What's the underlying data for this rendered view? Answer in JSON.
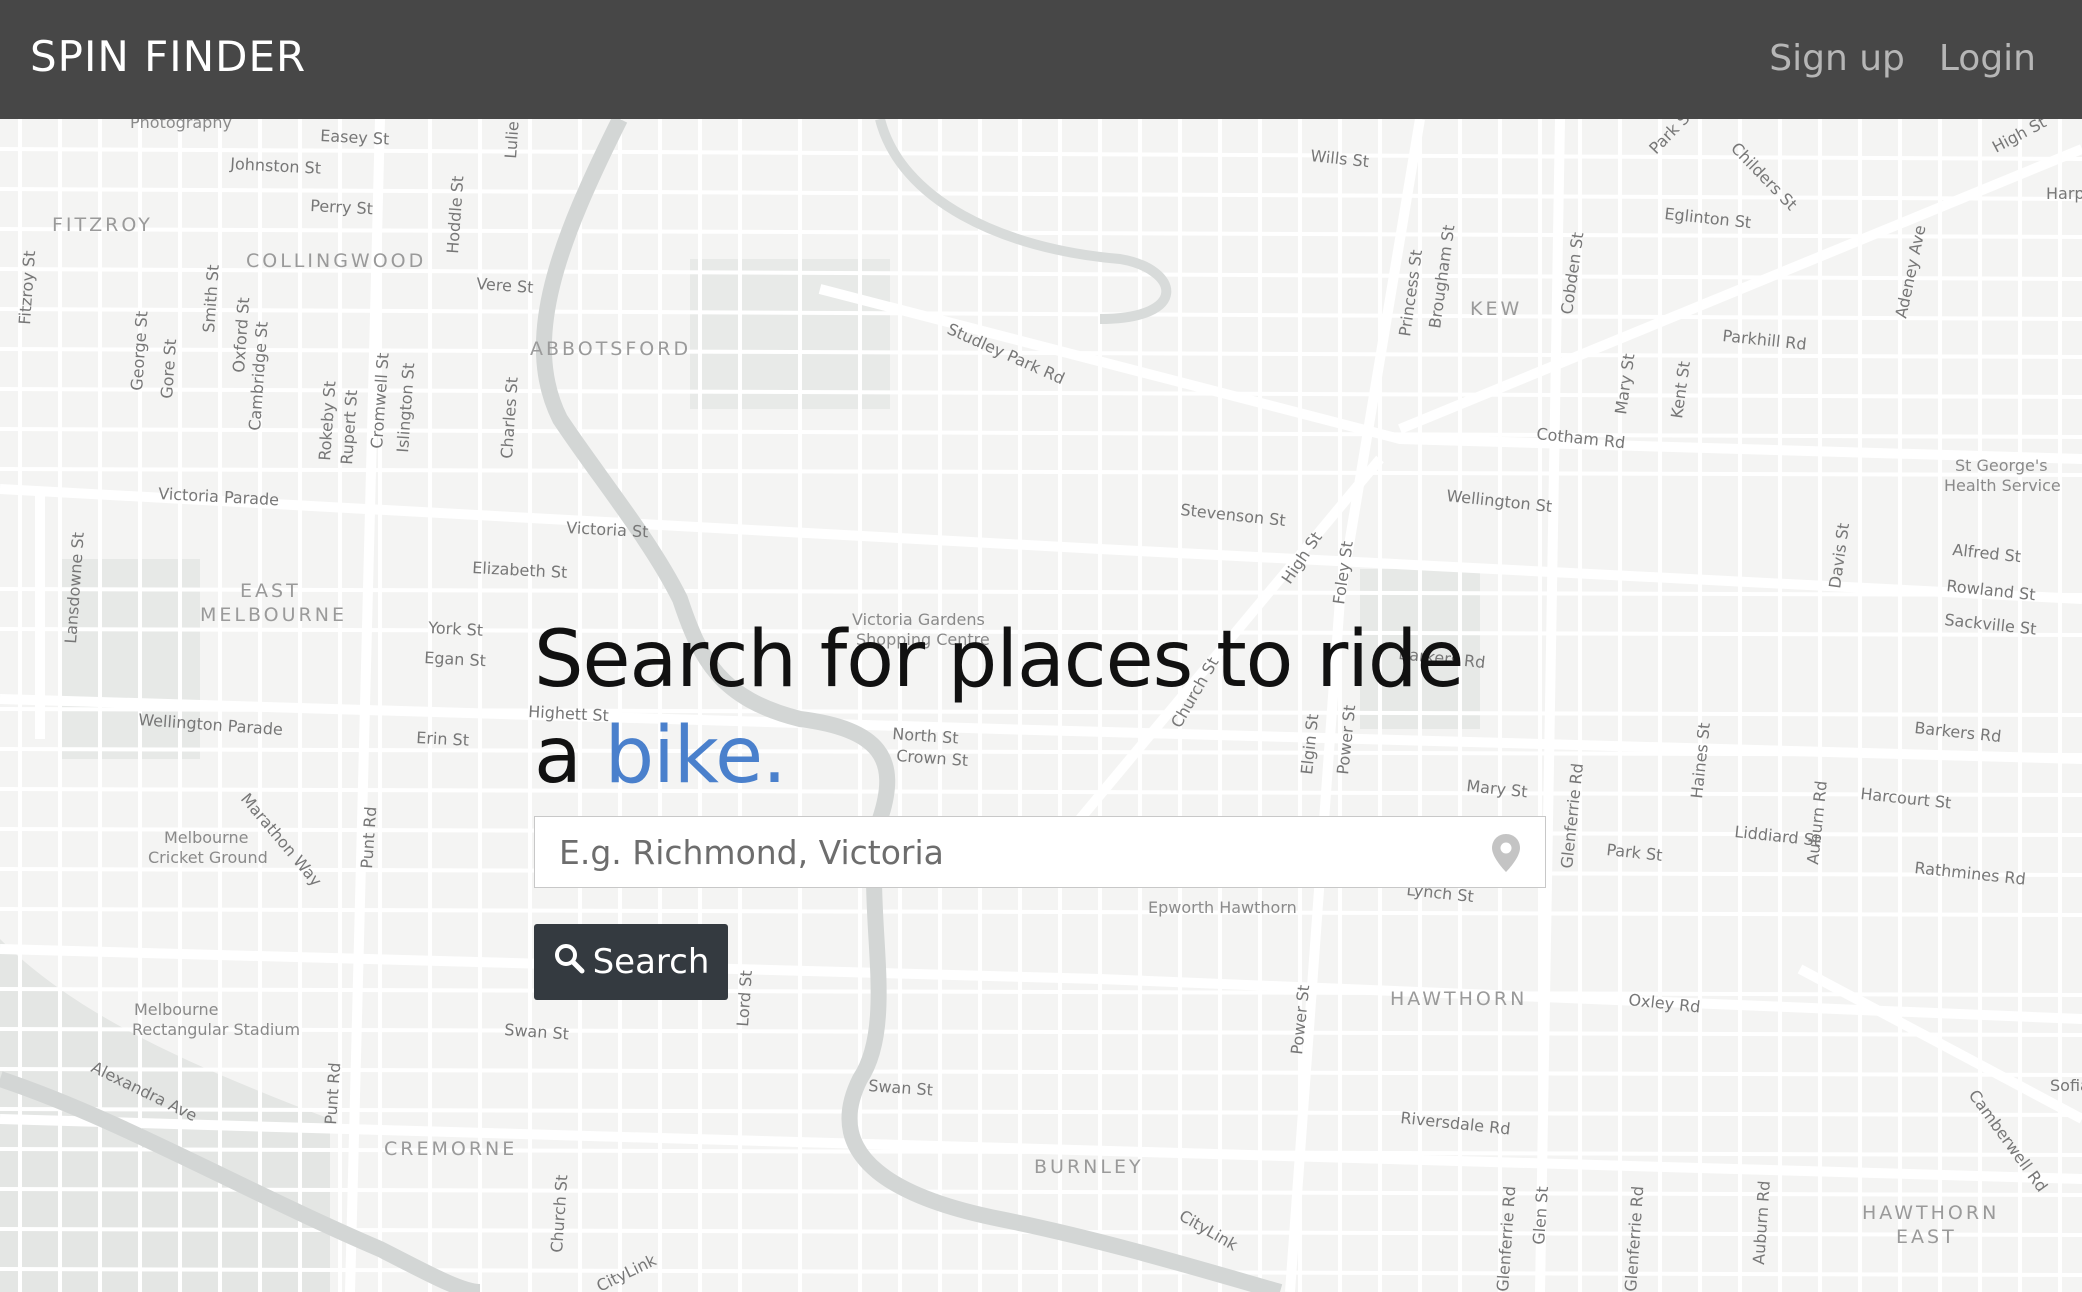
{
  "navbar": {
    "brand": "SPIN FINDER",
    "signup": "Sign up",
    "login": "Login"
  },
  "hero": {
    "headline_main": "Search for places to ride",
    "headline_prefix": "a ",
    "headline_accent": "bike."
  },
  "search": {
    "placeholder": "E.g. Richmond, Victoria",
    "value": "",
    "button_label": "Search",
    "button_icon": "search-icon",
    "field_icon": "map-pin-icon"
  },
  "colors": {
    "navbar": "#474747",
    "accent": "#4a80cc",
    "button": "#343a40",
    "map_background": "#f4f4f3"
  },
  "map": {
    "suburbs": [
      "FITZROY",
      "COLLINGWOOD",
      "ABBOTSFORD",
      "KEW",
      "EAST",
      "MELBOURNE",
      "HAWTHORN",
      "CREMORNE",
      "BURNLEY",
      "HAWTHORN",
      "EAST"
    ],
    "places": [
      "Photography",
      "Victoria Gardens",
      "Shopping Centre",
      "Melbourne",
      "Cricket Ground",
      "Melbourne",
      "Rectangular Stadium",
      "Epworth Hawthorn",
      "St George's",
      "Health Service"
    ],
    "streets": [
      "Easey St",
      "Johnston St",
      "Perry St",
      "Hoddle St",
      "Lulie St",
      "Fitzroy St",
      "George St",
      "Gore St",
      "Smith St",
      "Oxford St",
      "Cambridge St",
      "Rokeby St",
      "Rupert St",
      "Cromwell St",
      "Islington St",
      "Charles St",
      "Vere St",
      "Victoria Parade",
      "Lansdowne St",
      "Victoria St",
      "Elizabeth St",
      "York St",
      "Egan St",
      "Highett St",
      "Erin St",
      "Wellington Parade",
      "Marathon Way",
      "Punt Rd",
      "Swan St",
      "Lord St",
      "North St",
      "Crown St",
      "Alexandra Ave",
      "Punt Rd",
      "Church St",
      "Swan St",
      "Studley Park Rd",
      "Wills St",
      "Eglinton St",
      "Princess St",
      "Brougham St",
      "Cobden St",
      "Parkhill Rd",
      "Mary St",
      "Kent St",
      "Cotham Rd",
      "Adeney Ave",
      "Childers St",
      "Park St",
      "High St",
      "Stevenson St",
      "Wellington St",
      "High St",
      "Foley St",
      "Alfred St",
      "Rowland St",
      "Sackville St",
      "Davis St",
      "Barkers Rd",
      "Elgin St",
      "Power St",
      "Mary St",
      "Glenferrie Rd",
      "Haines St",
      "Harcourt St",
      "Liddiard St",
      "Park St",
      "Auburn Rd",
      "Rathmines Rd",
      "Lynch St",
      "Power St",
      "Oxley Rd",
      "Riversdale Rd",
      "Camberwell Rd",
      "Glenferrie Rd",
      "Glen St",
      "Auburn Rd",
      "CityLink",
      "CityLink",
      "Barkers Rd",
      "Church St",
      "Glenferrie Rd",
      "Harp",
      "Sofia"
    ]
  }
}
